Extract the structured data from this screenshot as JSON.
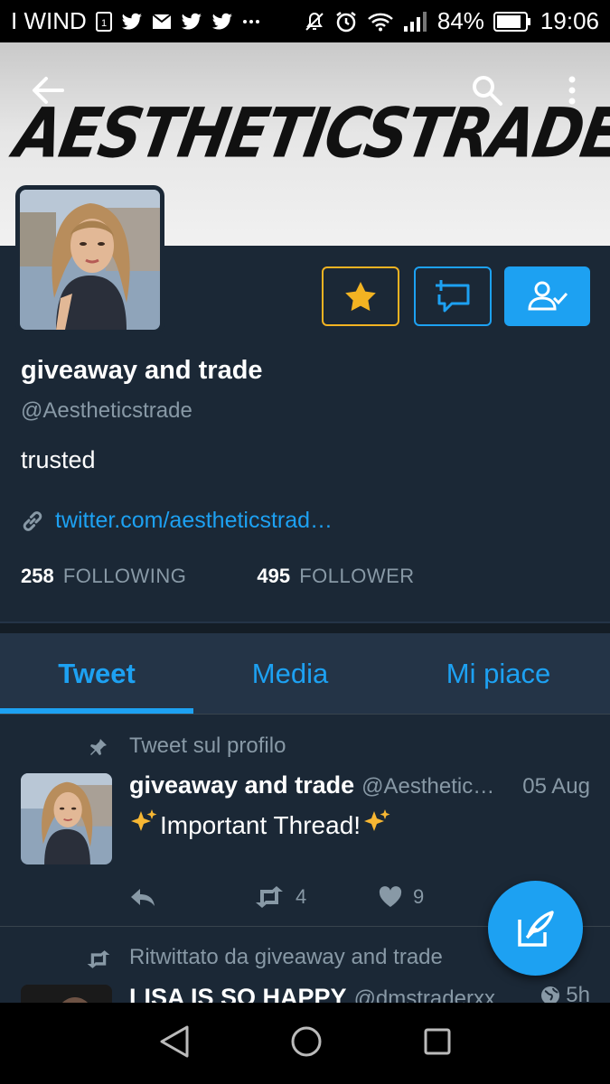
{
  "status_bar": {
    "carrier": "I WIND",
    "battery": "84%",
    "time": "19:06"
  },
  "header": {
    "banner_text": "AESTHETICSTRADE",
    "back_icon": "arrow-left-icon",
    "search_icon": "search-icon",
    "more_icon": "more-vert-icon"
  },
  "profile": {
    "name": "giveaway and trade",
    "handle": "@Aestheticstrade",
    "bio": "trusted",
    "link": "twitter.com/aestheticstrad…",
    "following_count": "258",
    "following_label": "FOLLOWING",
    "follower_count": "495",
    "follower_label": "FOLLOWER"
  },
  "tabs": [
    {
      "label": "Tweet",
      "active": true
    },
    {
      "label": "Media",
      "active": false
    },
    {
      "label": "Mi piace",
      "active": false
    }
  ],
  "tweets": [
    {
      "context": "Tweet sul profilo",
      "author": "giveaway and trade",
      "handle": "@Aesthetic…",
      "time": "05 Aug",
      "text": "Important Thread!",
      "retweets": "4",
      "likes": "9"
    },
    {
      "context": "Ritwittato da giveaway and trade",
      "author": "LISA IS SO HAPPY",
      "handle": "@dmstraderxx",
      "time": "5h"
    }
  ],
  "colors": {
    "background": "#1b2836",
    "accent": "#1da1f2",
    "favorite": "#f2b322",
    "muted": "#8899a6"
  }
}
